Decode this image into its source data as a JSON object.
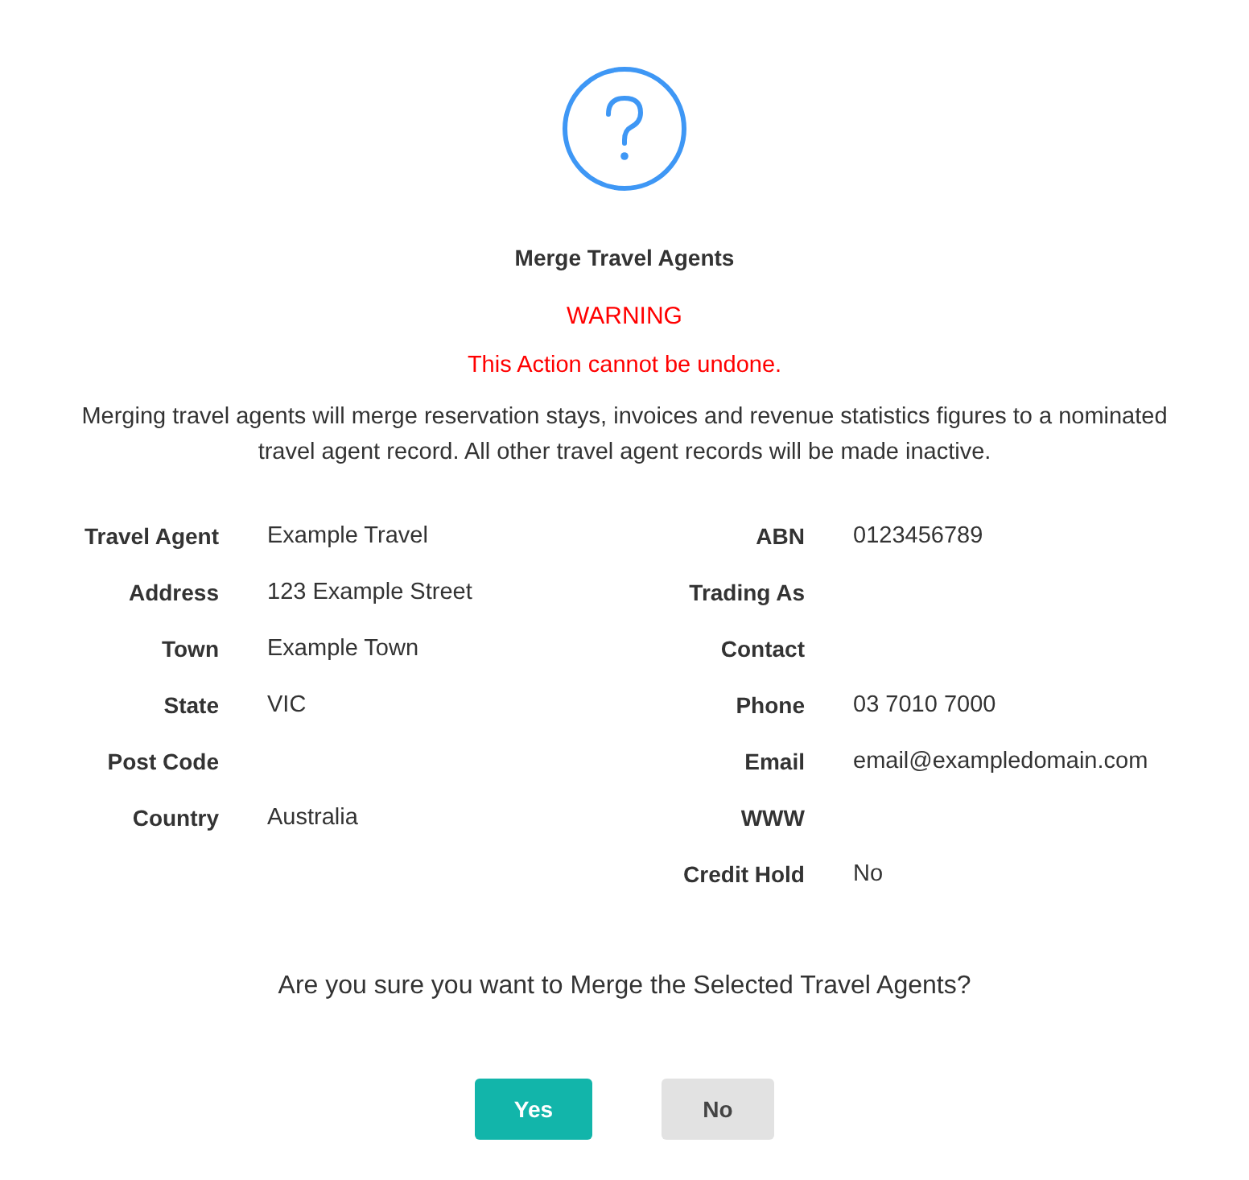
{
  "dialog": {
    "title": "Merge Travel Agents",
    "warning": "WARNING",
    "warning_detail": "This Action cannot be undone.",
    "description": "Merging travel agents will merge reservation stays, invoices and revenue statistics figures to a nominated travel agent record. All other travel agent records will be made inactive.",
    "left_fields": [
      {
        "label": "Travel Agent",
        "value": "Example Travel"
      },
      {
        "label": "Address",
        "value": "123 Example Street"
      },
      {
        "label": "Town",
        "value": "Example Town"
      },
      {
        "label": "State",
        "value": "VIC"
      },
      {
        "label": "Post Code"
      },
      {
        "label": "Country",
        "value": "Australia"
      }
    ],
    "right_fields": [
      {
        "label": "ABN",
        "value": "0123456789"
      },
      {
        "label": "Trading As"
      },
      {
        "label": "Contact"
      },
      {
        "label": "Phone",
        "value": "03 7010 7000"
      },
      {
        "label": "Email",
        "value": "email@exampledomain.com"
      },
      {
        "label": "WWW"
      },
      {
        "label": "Credit Hold",
        "value": "No"
      }
    ],
    "question": "Are you sure you want to Merge the Selected Travel Agents?",
    "buttons": [
      {
        "label": "Yes",
        "kind": "primary"
      },
      {
        "label": "No",
        "kind": "secondary"
      }
    ]
  }
}
